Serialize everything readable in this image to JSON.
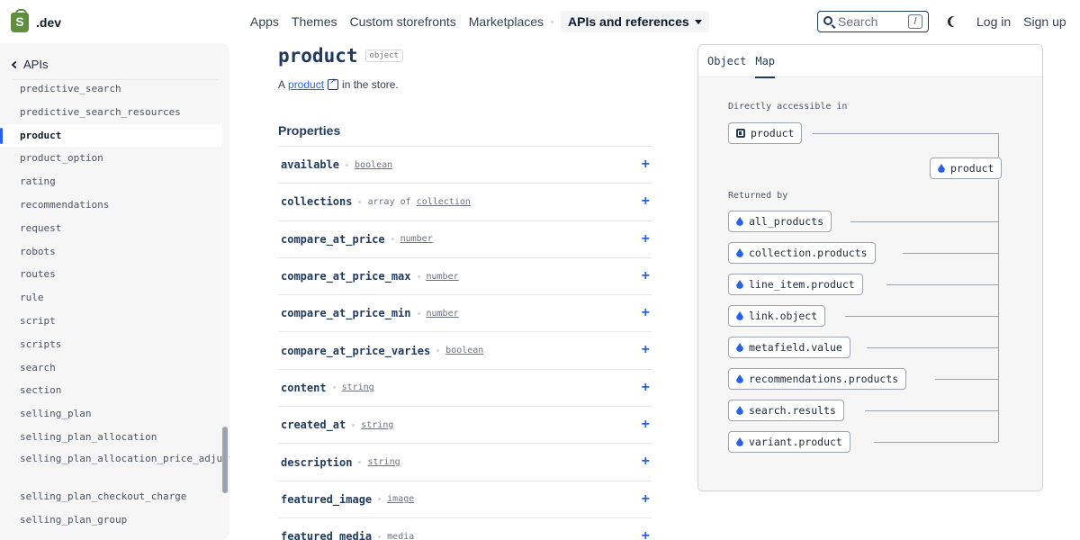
{
  "brand": {
    "name": ".dev"
  },
  "nav": {
    "items": [
      "Apps",
      "Themes",
      "Custom storefronts",
      "Marketplaces"
    ],
    "active": "APIs and references"
  },
  "search": {
    "placeholder": "Search",
    "shortcut": "/"
  },
  "auth": {
    "login": "Log in",
    "signup": "Sign up"
  },
  "sidebar": {
    "back_label": "APIs",
    "items": [
      "predictive_search",
      "predictive_search_resources",
      "product",
      "product_option",
      "rating",
      "recommendations",
      "request",
      "robots",
      "routes",
      "rule",
      "script",
      "scripts",
      "search",
      "section",
      "selling_plan",
      "selling_plan_allocation",
      "selling_plan_allocation_price_adjustment",
      "selling_plan_checkout_charge",
      "selling_plan_group"
    ],
    "active_index": 2
  },
  "main": {
    "title": "product",
    "type_pill": "object",
    "desc_prefix": "A",
    "desc_link": "product",
    "desc_suffix": "in the store.",
    "properties_heading": "Properties",
    "properties": [
      {
        "name": "available",
        "type": "boolean",
        "link": true
      },
      {
        "name": "collections",
        "type_prefix": "array of ",
        "type": "collection",
        "link": true
      },
      {
        "name": "compare_at_price",
        "type": "number",
        "link": true
      },
      {
        "name": "compare_at_price_max",
        "type": "number",
        "link": true
      },
      {
        "name": "compare_at_price_min",
        "type": "number",
        "link": true
      },
      {
        "name": "compare_at_price_varies",
        "type": "boolean",
        "link": true
      },
      {
        "name": "content",
        "type": "string",
        "link": true
      },
      {
        "name": "created_at",
        "type": "string",
        "link": true
      },
      {
        "name": "description",
        "type": "string",
        "link": true
      },
      {
        "name": "featured_image",
        "type": "image",
        "link": true
      },
      {
        "name": "featured_media",
        "type": "media",
        "link": false
      }
    ],
    "expand_symbol": "+"
  },
  "panel": {
    "tabs": [
      "Object",
      "Map"
    ],
    "active_tab": "Map",
    "directly_label": "Directly accessible in",
    "directly_items": [
      "product"
    ],
    "target": "product",
    "returned_label": "Returned by",
    "returned_items": [
      "all_products",
      "collection.products",
      "line_item.product",
      "link.object",
      "metafield.value",
      "recommendations.products",
      "search.results",
      "variant.product"
    ]
  }
}
